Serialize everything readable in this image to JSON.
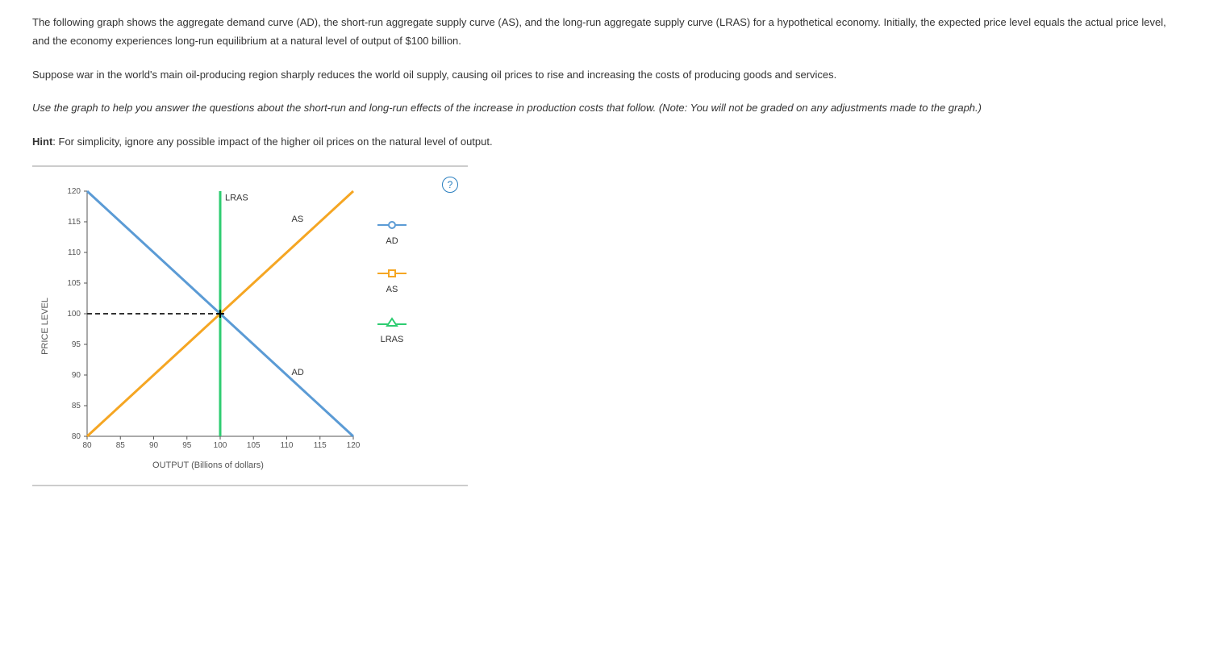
{
  "question": {
    "p1": "The following graph shows the aggregate demand curve (AD), the short-run aggregate supply curve (AS), and the long-run aggregate supply curve (LRAS) for a hypothetical economy. Initially, the expected price level equals the actual price level, and the economy experiences long-run equilibrium at a natural level of output of $100 billion.",
    "p2": "Suppose war in the world's main oil-producing region sharply reduces the world oil supply, causing oil prices to rise and increasing the costs of producing goods and services.",
    "p3": "Use the graph to help you answer the questions about the short-run and long-run effects of the increase in production costs that follow. (Note: You will not be graded on any adjustments made to the graph.)",
    "hint_label": "Hint",
    "hint_text": ": For simplicity, ignore any possible impact of the higher oil prices on the natural level of output."
  },
  "legend": {
    "ad": "AD",
    "as": "AS",
    "lras": "LRAS"
  },
  "chart_data": {
    "type": "line",
    "title": "",
    "xlabel": "OUTPUT (Billions of dollars)",
    "ylabel": "PRICE LEVEL",
    "xlim": [
      80,
      120
    ],
    "ylim": [
      80,
      120
    ],
    "x_ticks": [
      80,
      85,
      90,
      95,
      100,
      105,
      110,
      115,
      120
    ],
    "y_ticks": [
      80,
      85,
      90,
      95,
      100,
      105,
      110,
      115,
      120
    ],
    "series": [
      {
        "name": "AD",
        "color": "#5b9bd5",
        "points": [
          [
            80,
            120
          ],
          [
            120,
            80
          ]
        ],
        "label_at": [
          110,
          90
        ]
      },
      {
        "name": "AS",
        "color": "#f5a623",
        "points": [
          [
            80,
            80
          ],
          [
            120,
            120
          ]
        ],
        "label_at": [
          110,
          115
        ]
      },
      {
        "name": "LRAS",
        "color": "#2ecc71",
        "points": [
          [
            100,
            80
          ],
          [
            100,
            120
          ]
        ],
        "label_at": [
          100,
          118.5
        ]
      }
    ],
    "equilibrium": {
      "x": 100,
      "y": 100
    },
    "guide_lines": [
      {
        "from": [
          80,
          100
        ],
        "to": [
          100,
          100
        ]
      },
      {
        "from": [
          100,
          80
        ],
        "to": [
          100,
          100
        ]
      }
    ]
  },
  "colors": {
    "ad": "#5b9bd5",
    "as": "#f5a623",
    "lras": "#2ecc71",
    "axis": "#555",
    "dash": "#333"
  },
  "help_tooltip": "?"
}
